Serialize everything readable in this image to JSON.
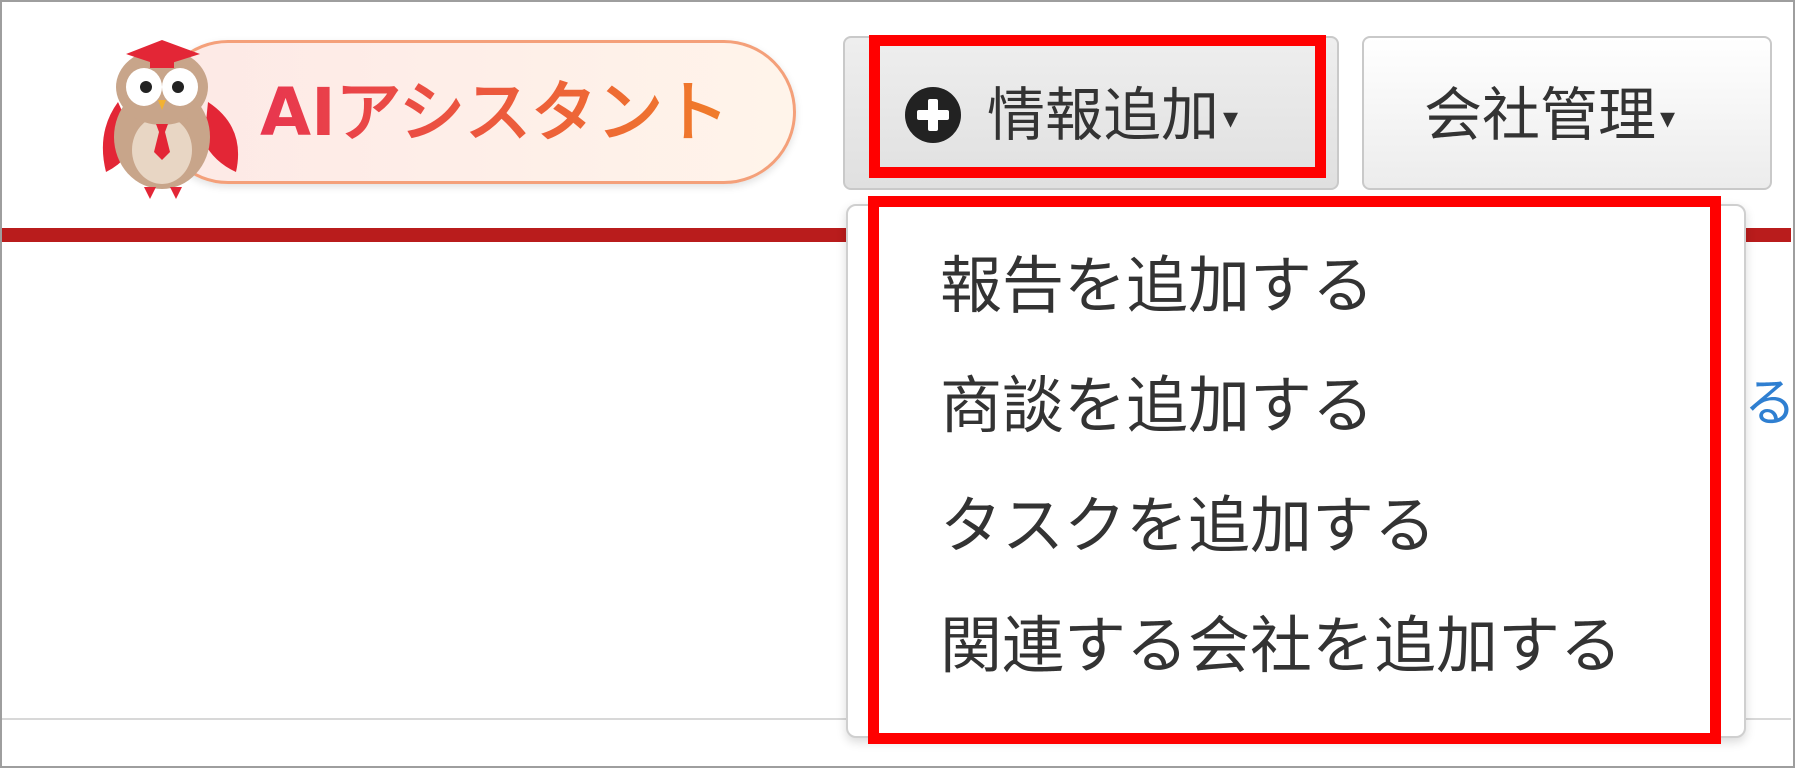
{
  "header": {
    "ai_assistant": {
      "label": "AIアシスタント",
      "colors": {
        "text_start": "#e8364f",
        "text_end": "#f07d2a",
        "border": "#f4a07a"
      }
    },
    "add_info_button": {
      "label": "情報追加",
      "icon": "plus-circle-icon",
      "caret": "▾"
    },
    "company_button": {
      "label": "会社管理",
      "caret": "▾"
    }
  },
  "dropdown": {
    "items": [
      {
        "label": "報告を追加する"
      },
      {
        "label": "商談を追加する"
      },
      {
        "label": "タスクを追加する"
      },
      {
        "label": "関連する会社を追加する"
      }
    ]
  },
  "theme": {
    "accent_rule": "#b91c1c",
    "highlight": "#ff0000"
  }
}
